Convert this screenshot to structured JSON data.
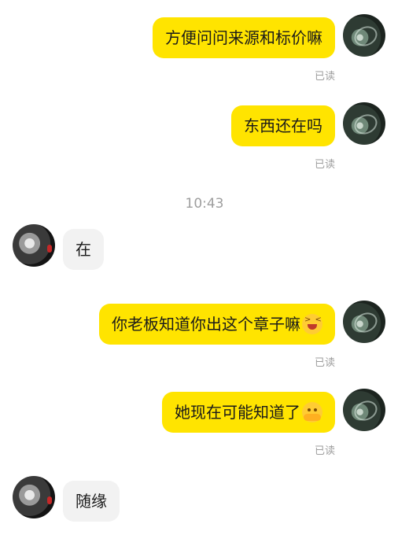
{
  "messages": [
    {
      "side": "me",
      "text": "方便问问来源和标价嘛",
      "read": "已读"
    },
    {
      "side": "me",
      "text": "东西还在吗",
      "read": "已读"
    },
    {
      "side": "them",
      "text": "在"
    },
    {
      "side": "me",
      "text": "你老板知道你出这个章子嘛",
      "read": "已读",
      "emoji": "grinning-squint-emoji"
    },
    {
      "side": "me",
      "text": "她现在可能知道了",
      "read": "已读",
      "emoji": "hugging-emoji"
    },
    {
      "side": "them",
      "text": "随缘"
    }
  ],
  "timestamp": "10:43",
  "colors": {
    "my_bubble": "#ffe400",
    "their_bubble": "#f2f2f2",
    "meta_text": "#9e9e9e"
  }
}
